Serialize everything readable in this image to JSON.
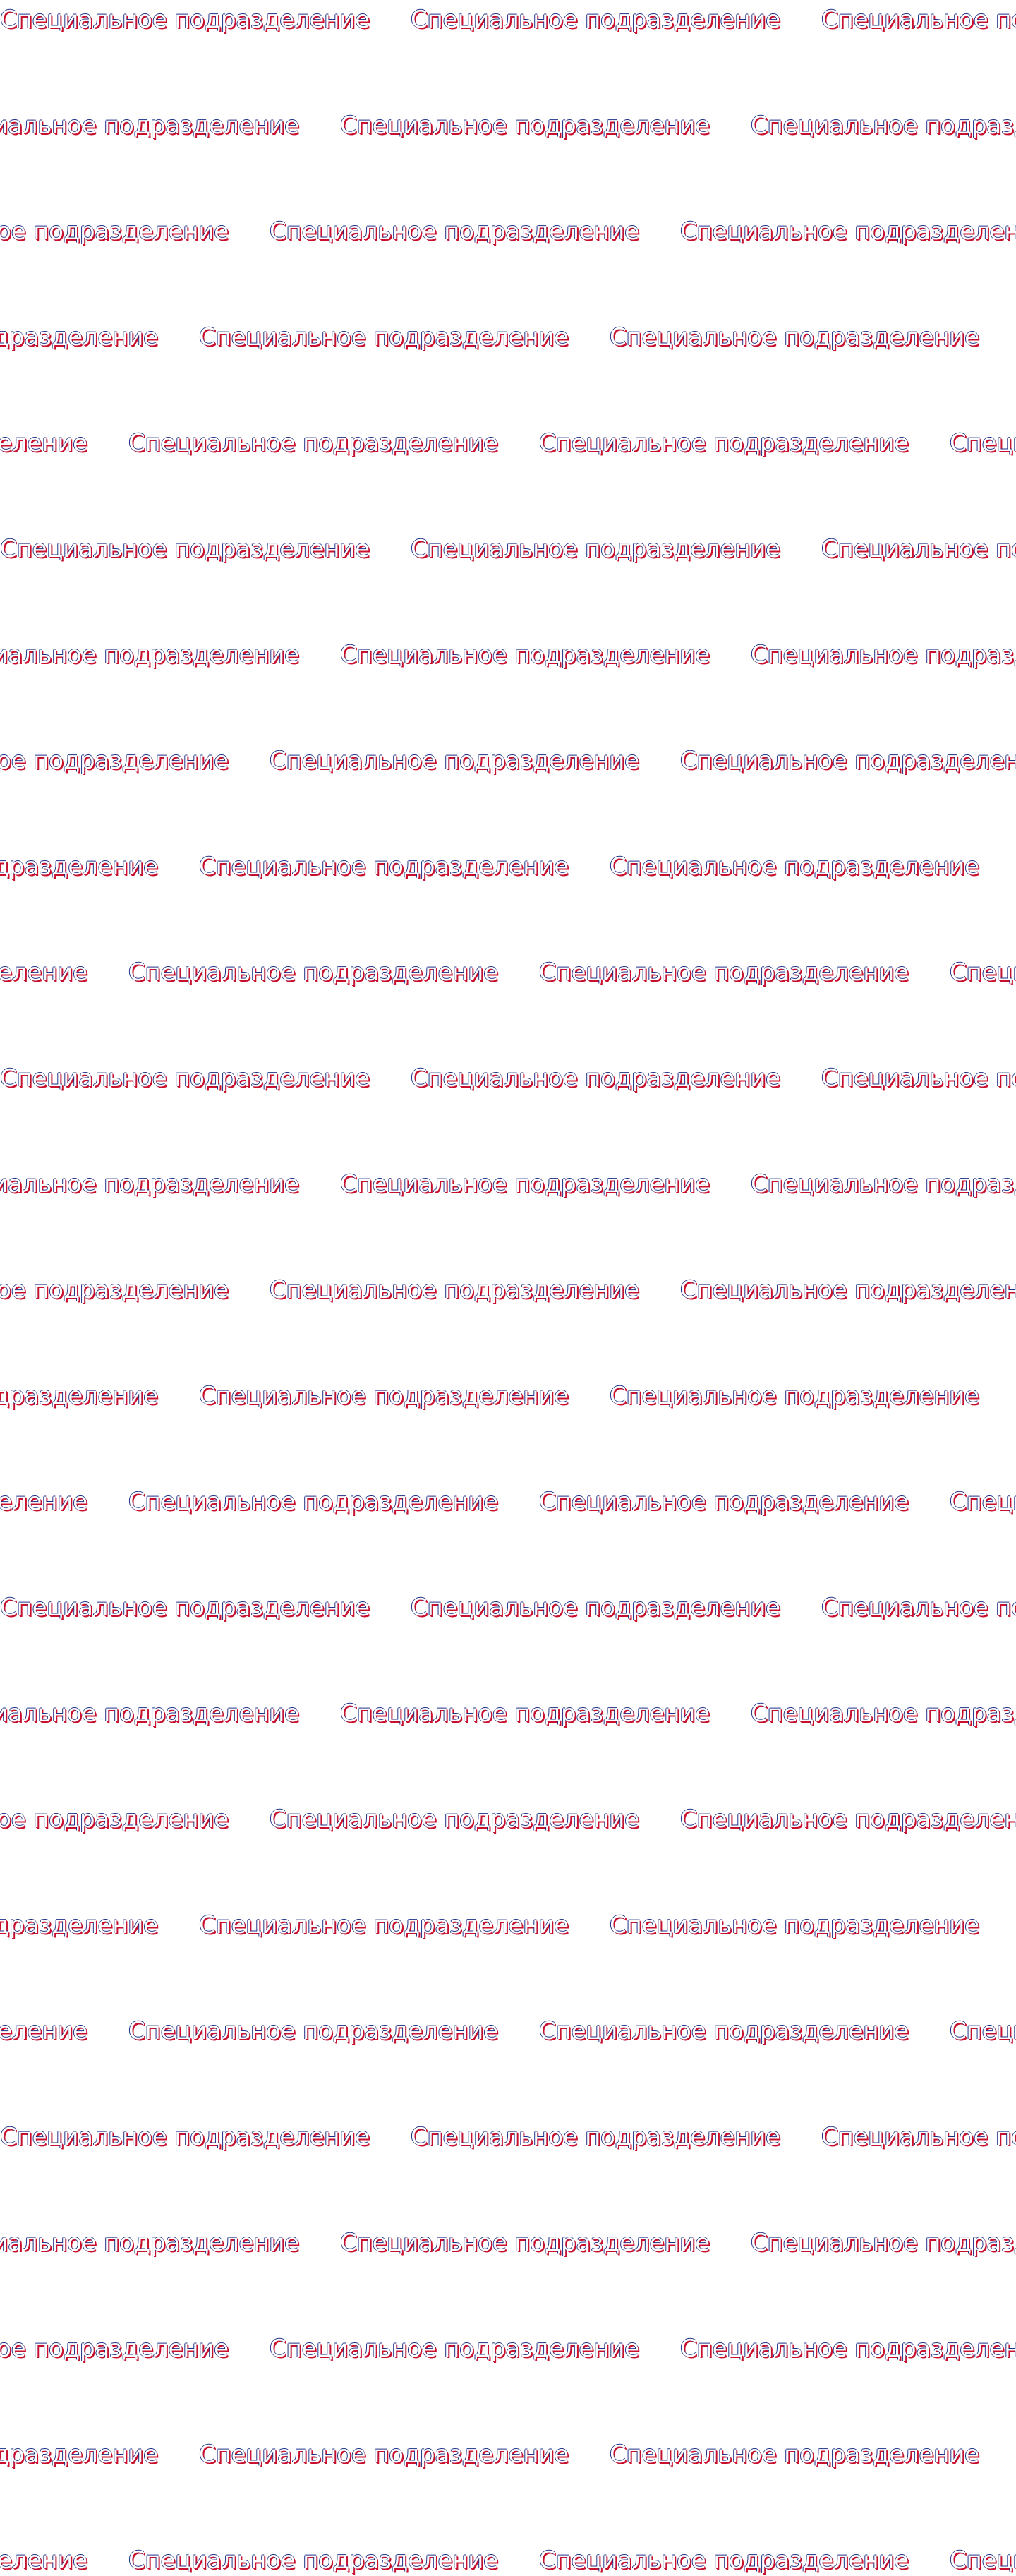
{
  "pattern": {
    "label": "Специальное подразделение",
    "colors": {
      "fill": "#ffffff",
      "shadow_blue": "#1c2f86",
      "shadow_red": "#c8102e"
    }
  }
}
